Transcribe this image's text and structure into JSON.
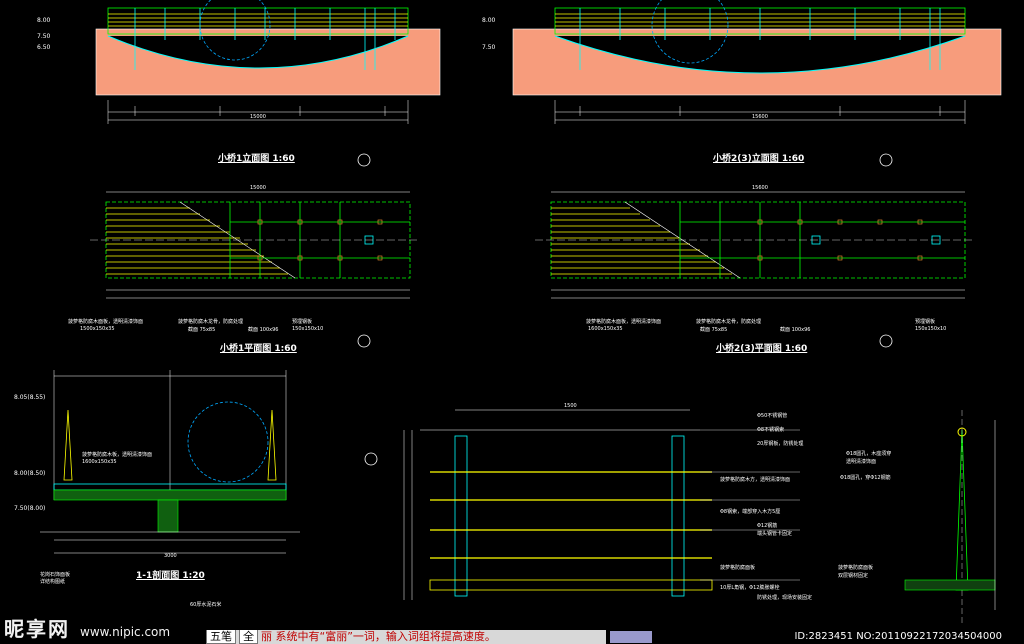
{
  "titles": {
    "elev1": "小桥1立面图 1:60",
    "elev2": "小桥2(3)立面图 1:60",
    "plan1": "小桥1平面图 1:60",
    "plan2": "小桥2(3)平面图 1:60",
    "section": "1-1剖面图 1:20"
  },
  "levels": {
    "l1": "8.00",
    "l2": "7.50",
    "l3": "6.50",
    "l4": "8.00",
    "l5": "7.50",
    "s1": "8.05(8.55)",
    "s2": "8.00(8.50)",
    "s3": "7.50(8.00)"
  },
  "dims": {
    "e1_total": "15000",
    "e2_total": "15600",
    "p1_total": "15000",
    "p2_total": "15600",
    "sec_total": "3000",
    "detail_w": "1500"
  },
  "plan_notes1": [
    "菠萝格防腐木面板，透明清漆饰面",
    "菠萝格防腐木龙骨，防腐处理",
    "预埋钢板"
  ],
  "plan_notes1b": [
    "1500x150x35",
    "截面 75x85",
    "截面 100x96",
    "150x150x10"
  ],
  "plan_notes2": [
    "菠萝格防腐木面板，透明清漆饰面",
    "菠萝格防腐木龙骨，防腐处理",
    "预埋钢板"
  ],
  "plan_notes2b": [
    "1600x150x35",
    "截面 75x85",
    "截面 100x96",
    "150x150x10"
  ],
  "section_notes": [
    "菠萝格防腐木板，透明清漆饰面",
    "1600x150x35",
    "花岗石饰面板",
    "详结构图纸",
    "60厚水泥石米"
  ],
  "detail_notes": [
    "Φ50不锈钢管",
    "Φ8不锈钢索",
    "20厚钢板，防锈处理",
    "菠萝格防腐木方，透明清漆饰面",
    "Φ8钢索，端部穿入木方5厘",
    "Φ12钢筋",
    "端头钢管卡固定",
    "菠萝格防腐面板",
    "10厚L角钢，Φ12膨胀螺栓",
    "防锈处理，现场安装固定"
  ],
  "side_notes": [
    "Φ18圆孔，木座须穿",
    "透明清漆饰面",
    "Φ18圆孔，穿Φ12钢筋",
    "菠萝格防腐面板",
    "双层钢材固定"
  ],
  "watermark": {
    "brand": "昵享网",
    "url": "www.nipic.com",
    "id": "ID:2823451 NO:20110922172034504000"
  },
  "ime": {
    "label1": "五笔",
    "label2": "全",
    "text": "丽    系统中有“富丽”一词，输入词组将提高速度。"
  },
  "colors": {
    "fill": "#f79c7c",
    "rail": "#ffff00",
    "line": "#00ffff",
    "struct": "#00c000"
  }
}
